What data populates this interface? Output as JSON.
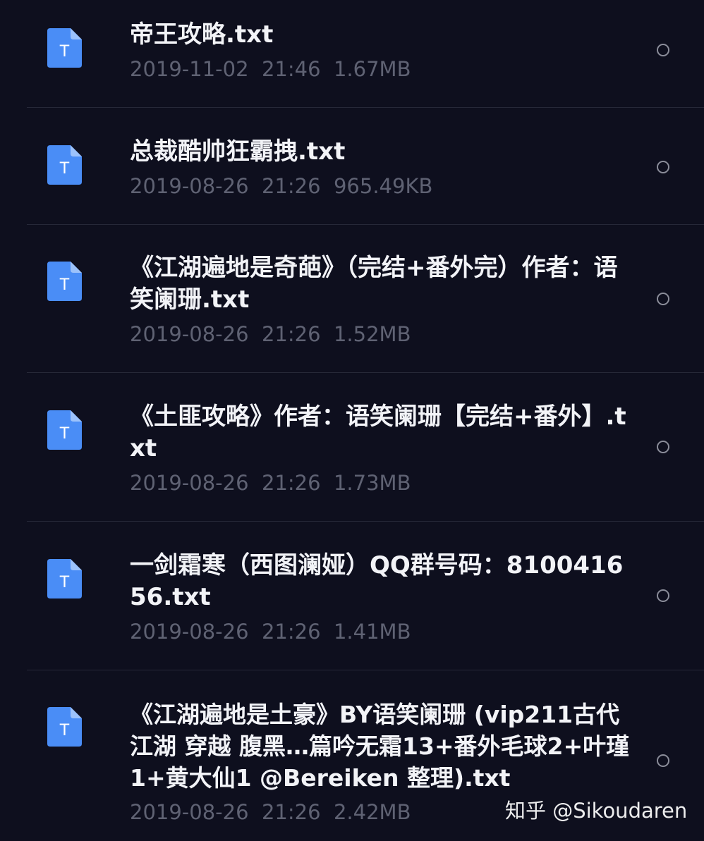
{
  "files": [
    {
      "name": "帝王攻略.txt",
      "meta": "2019-11-02  21:46  1.67MB",
      "icon": "text-file-icon",
      "icon_letter": "T",
      "selected": false
    },
    {
      "name": "总裁酷帅狂霸拽.txt",
      "meta": "2019-08-26  21:26  965.49KB",
      "icon": "text-file-icon",
      "icon_letter": "T",
      "selected": false
    },
    {
      "name": "《江湖遍地是奇葩》（完结+番外完）作者：语笑阑珊.txt",
      "meta": "2019-08-26  21:26  1.52MB",
      "icon": "text-file-icon",
      "icon_letter": "T",
      "selected": false
    },
    {
      "name": "《土匪攻略》作者：语笑阑珊【完结+番外】.txt",
      "meta": "2019-08-26  21:26  1.73MB",
      "icon": "text-file-icon",
      "icon_letter": "T",
      "selected": false
    },
    {
      "name": "一剑霜寒（西图澜娅）QQ群号码：810041656.txt",
      "meta": "2019-08-26  21:26  1.41MB",
      "icon": "text-file-icon",
      "icon_letter": "T",
      "selected": false
    },
    {
      "name": "《江湖遍地是土豪》BY语笑阑珊 (vip211古代江湖 穿越 腹黑…篇吟无霜13+番外毛球2+叶瑾1+黄大仙1 @Bereiken 整理).txt",
      "meta": "2019-08-26  21:26  2.42MB",
      "icon": "text-file-icon",
      "icon_letter": "T",
      "selected": false
    }
  ],
  "watermark": "知乎 @Sikoudaren",
  "colors": {
    "background": "#0e0f1e",
    "title": "#f2f3f7",
    "meta": "#5f6273",
    "icon_blue": "#4a8df6",
    "icon_fold": "#9cc2fb",
    "divider": "#262838",
    "radio": "#8a8c99"
  }
}
